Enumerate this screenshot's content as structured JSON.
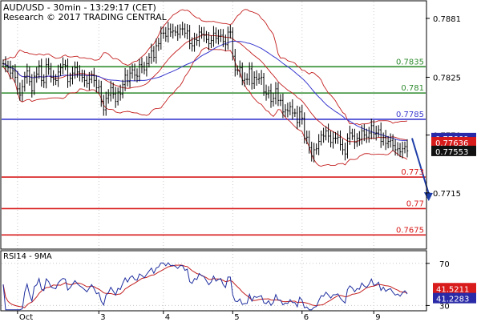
{
  "chart_data": [
    {
      "type": "candlestick",
      "header_line1": "AUD/USD - 30min - 13:29:17 (CET)",
      "header_line2": "Research © 2017 TRADING CENTRAL",
      "x_axis": {
        "tick_labels": [
          "Oct",
          "3",
          "4",
          "5",
          "6",
          "9"
        ],
        "tick_bar_index": [
          6,
          40,
          67,
          96,
          125,
          155
        ]
      },
      "y_axis": {
        "range": [
          0.76615,
          0.78985
        ],
        "tick_labels": [
          "0.7881",
          "0.7825",
          "0.7770",
          "0.7715"
        ],
        "tick_values": [
          0.7881,
          0.7825,
          0.777,
          0.7715
        ]
      },
      "levels": [
        {
          "label": "0.7835",
          "value": 0.7835,
          "color": "#2e8b2e"
        },
        {
          "label": "0.781",
          "value": 0.781,
          "color": "#2e8b2e"
        },
        {
          "label": "0.7785",
          "value": 0.7785,
          "color": "#3a3acf"
        },
        {
          "label": "0.773",
          "value": 0.773,
          "color": "#d81b1b"
        },
        {
          "label": "0.77",
          "value": 0.77,
          "color": "#d81b1b"
        },
        {
          "label": "0.7675",
          "value": 0.7675,
          "color": "#d81b1b"
        }
      ],
      "price_markers": [
        {
          "label": "0.77660",
          "value": 0.7766,
          "bg": "#2a2aa8"
        },
        {
          "label": "0.77636",
          "value": 0.77636,
          "bg": "#d81b1b"
        },
        {
          "label": "0.77553",
          "value": 0.77553,
          "bg": "#111111"
        }
      ],
      "forecast_arrow": {
        "from": [
          171,
          0.7767
        ],
        "to": [
          178,
          0.7708
        ],
        "color": "#1f3fa8"
      },
      "close_series": [
        0.7838,
        0.7836,
        0.7834,
        0.7829,
        0.7831,
        0.7825,
        0.7814,
        0.7808,
        0.7816,
        0.7825,
        0.7831,
        0.7821,
        0.7812,
        0.7826,
        0.7828,
        0.7836,
        0.7822,
        0.782,
        0.7837,
        0.7833,
        0.7825,
        0.7823,
        0.7822,
        0.783,
        0.7834,
        0.7837,
        0.7836,
        0.7821,
        0.7824,
        0.7829,
        0.7834,
        0.783,
        0.7827,
        0.7825,
        0.7822,
        0.7819,
        0.7823,
        0.7827,
        0.7822,
        0.7815,
        0.7816,
        0.7802,
        0.7794,
        0.7805,
        0.7808,
        0.7815,
        0.7809,
        0.7802,
        0.7811,
        0.7809,
        0.7818,
        0.7827,
        0.7821,
        0.7829,
        0.7832,
        0.7827,
        0.7826,
        0.7837,
        0.7835,
        0.7832,
        0.7838,
        0.7844,
        0.785,
        0.7844,
        0.7855,
        0.7857,
        0.7867,
        0.7867,
        0.7864,
        0.7871,
        0.7868,
        0.7869,
        0.7868,
        0.7866,
        0.7871,
        0.7871,
        0.7867,
        0.7869,
        0.7857,
        0.7855,
        0.7861,
        0.786,
        0.7868,
        0.7866,
        0.7865,
        0.7861,
        0.7857,
        0.786,
        0.7867,
        0.7862,
        0.7864,
        0.7865,
        0.7859,
        0.7856,
        0.7868,
        0.7868,
        0.7845,
        0.7832,
        0.7831,
        0.7834,
        0.7822,
        0.7823,
        0.7823,
        0.7833,
        0.7819,
        0.7825,
        0.7823,
        0.7824,
        0.7825,
        0.7811,
        0.7809,
        0.7812,
        0.7802,
        0.7805,
        0.7814,
        0.7803,
        0.7803,
        0.7792,
        0.7794,
        0.7793,
        0.7797,
        0.7791,
        0.7791,
        0.7782,
        0.7792,
        0.7786,
        0.7767,
        0.7768,
        0.7758,
        0.775,
        0.7756,
        0.7757,
        0.7764,
        0.777,
        0.7769,
        0.7774,
        0.7769,
        0.7763,
        0.7767,
        0.7767,
        0.7768,
        0.7761,
        0.7756,
        0.7752,
        0.7767,
        0.7772,
        0.7769,
        0.7763,
        0.7767,
        0.7766,
        0.7774,
        0.777,
        0.7768,
        0.7772,
        0.7779,
        0.7771,
        0.7772,
        0.7775,
        0.7764,
        0.7768,
        0.7762,
        0.7764,
        0.7765,
        0.776,
        0.7756,
        0.7757,
        0.7754,
        0.7757,
        0.7759,
        0.7755
      ],
      "rsi_panel": {
        "label": "RSI14 - 9MA",
        "range": [
          25,
          82
        ],
        "tick_labels": [
          "70",
          "30"
        ],
        "tick_values": [
          70,
          30
        ],
        "markers": [
          {
            "label": "41.5211",
            "value": 41.5211,
            "bg": "#d81b1b"
          },
          {
            "label": "41.2283",
            "value": 41.2283,
            "bg": "#2a2aa8"
          }
        ]
      }
    }
  ]
}
